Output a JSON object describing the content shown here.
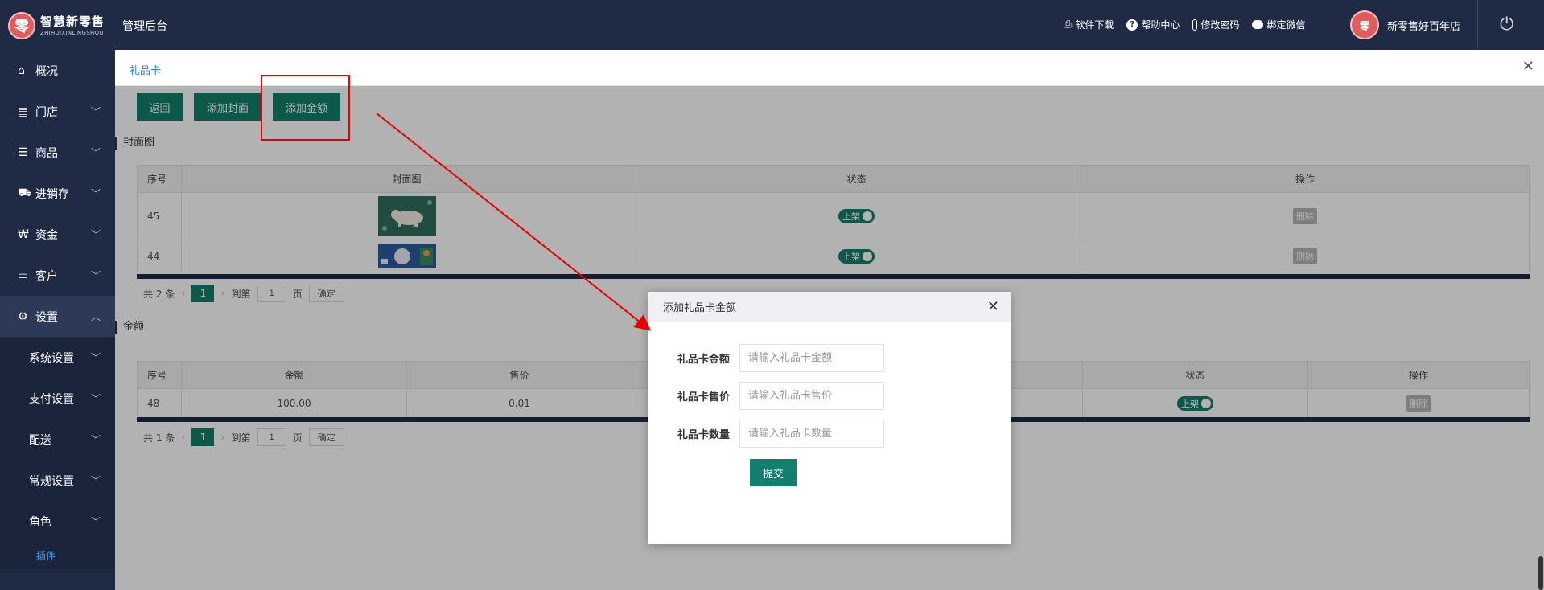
{
  "header": {
    "logo_cn": "智慧新零售",
    "logo_en": "ZHIHUIXINLINGSHOU",
    "logo_glyph": "零",
    "app_title": "管理后台",
    "links": [
      {
        "icon": "printer-icon",
        "glyph": "⎙",
        "label": "软件下载"
      },
      {
        "icon": "help-icon",
        "glyph": "?",
        "label": "帮助中心"
      },
      {
        "icon": "thermometer-icon",
        "glyph": "🌡",
        "label": "修改密码"
      },
      {
        "icon": "chat-icon",
        "glyph": "💬",
        "label": "绑定微信"
      }
    ],
    "user_name": "新零售好百年店",
    "avatar_glyph": "零",
    "power_glyph": "⏻"
  },
  "sidebar": {
    "items": [
      {
        "label": "概况",
        "glyph": "⌂",
        "icon": "home-icon",
        "has_chevron": false
      },
      {
        "label": "门店",
        "glyph": "▤",
        "icon": "building-icon",
        "has_chevron": true
      },
      {
        "label": "商品",
        "glyph": "☰",
        "icon": "list-icon",
        "has_chevron": true
      },
      {
        "label": "进销存",
        "glyph": "⛟",
        "icon": "truck-icon",
        "has_chevron": true
      },
      {
        "label": "资金",
        "glyph": "₩",
        "icon": "currency-icon",
        "has_chevron": true
      },
      {
        "label": "客户",
        "glyph": "▭",
        "icon": "id-card-icon",
        "has_chevron": true
      },
      {
        "label": "设置",
        "glyph": "⚙",
        "icon": "gear-icon",
        "has_chevron": true
      }
    ],
    "sub_items": [
      "系统设置",
      "支付设置",
      "配送",
      "常规设置",
      "角色"
    ],
    "plugin_link": "插件"
  },
  "tab": {
    "label": "礼品卡",
    "close_glyph": "✕"
  },
  "toolbar": {
    "back": "返回",
    "add_cover": "添加封面",
    "add_amount": "添加金额"
  },
  "cover_section": {
    "title": "封面图",
    "columns": [
      "序号",
      "封面图",
      "状态",
      "操作"
    ],
    "rows": [
      {
        "id": "45",
        "status": "上架",
        "action": "删除"
      },
      {
        "id": "44",
        "status": "上架",
        "action": "删除"
      }
    ],
    "pager": {
      "total": "共 2 条",
      "current": "1",
      "goto": "到第",
      "page_value": "1",
      "page_unit": "页",
      "ok": "确定"
    }
  },
  "amount_section": {
    "title": "金额",
    "columns": [
      "序号",
      "金额",
      "售价",
      "状态",
      "操作"
    ],
    "rows": [
      {
        "id": "48",
        "amount": "100.00",
        "price": "0.01",
        "status": "上架",
        "action": "删除"
      }
    ],
    "pager": {
      "total": "共 1 条",
      "current": "1",
      "goto": "到第",
      "page_value": "1",
      "page_unit": "页",
      "ok": "确定"
    }
  },
  "modal": {
    "title": "添加礼品卡金额",
    "close_glyph": "✕",
    "fields": [
      {
        "label": "礼品卡金额",
        "placeholder": "请输入礼品卡金额"
      },
      {
        "label": "礼品卡售价",
        "placeholder": "请输入礼品卡售价"
      },
      {
        "label": "礼品卡数量",
        "placeholder": "请输入礼品卡数量"
      }
    ],
    "submit": "提交"
  },
  "colors": {
    "primary": "#12806e",
    "nav_bg": "#1f2b45",
    "annotation": "#e60000",
    "tab_blue": "#1e88e5"
  }
}
